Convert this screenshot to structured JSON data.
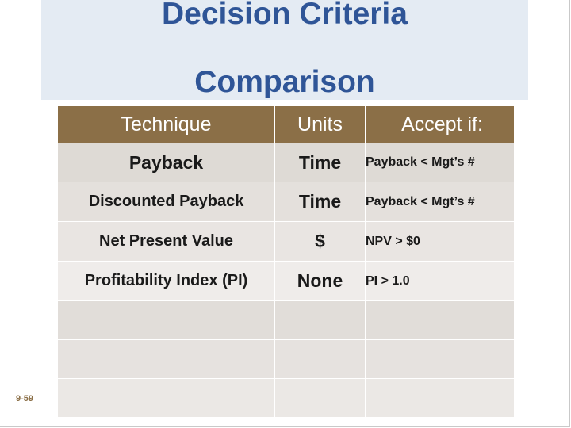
{
  "slide": {
    "title_lines": [
      "Decision Criteria",
      "Comparison"
    ],
    "page_number": "9-59",
    "colors": {
      "title_text": "#2f5597",
      "title_band": "#e4ebf3",
      "header_row": "#8b6f47",
      "body_row": "#e4e0dc",
      "page_number": "#8b6f47"
    }
  },
  "table": {
    "headers": [
      "Technique",
      "Units",
      "Accept if:"
    ],
    "rows": [
      {
        "technique": "Payback",
        "units": "Time",
        "accept": "Payback < Mgt’s #"
      },
      {
        "technique": "Discounted Payback",
        "units": "Time",
        "accept": "Payback < Mgt’s #"
      },
      {
        "technique": "Net Present Value",
        "units": "$",
        "accept": "NPV > $0"
      },
      {
        "technique": "Profitability Index (PI)",
        "units": "None",
        "accept": "PI > 1.0"
      },
      {
        "technique": "",
        "units": "",
        "accept": ""
      },
      {
        "technique": "",
        "units": "",
        "accept": ""
      },
      {
        "technique": "",
        "units": "",
        "accept": ""
      }
    ]
  }
}
